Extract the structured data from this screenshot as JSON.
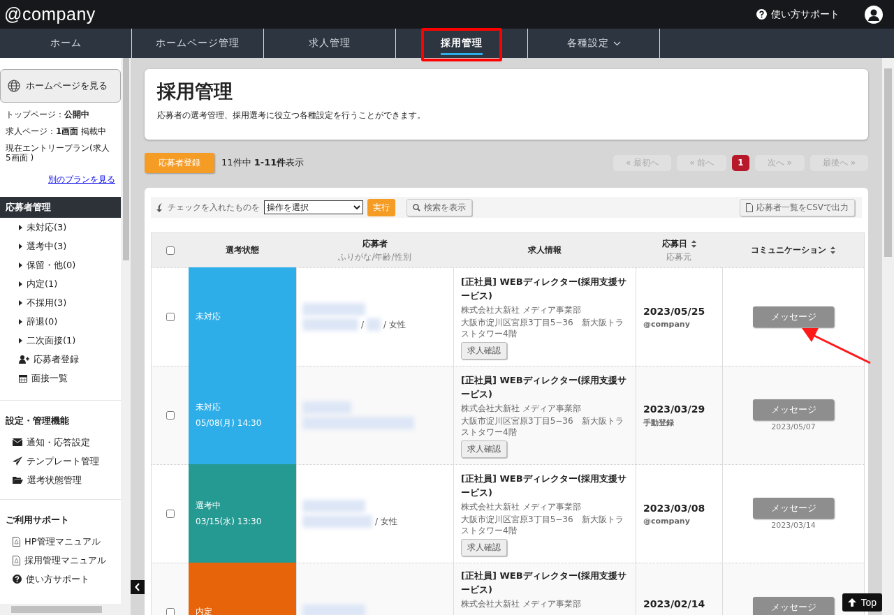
{
  "header": {
    "logo": "@company",
    "support": "使い方サポート"
  },
  "nav": [
    {
      "label": "ホーム",
      "selected": false,
      "dropdown": false,
      "highlighted": false
    },
    {
      "label": "ホームページ管理",
      "selected": false,
      "dropdown": false,
      "highlighted": false
    },
    {
      "label": "求人管理",
      "selected": false,
      "dropdown": false,
      "highlighted": false
    },
    {
      "label": "採用管理",
      "selected": true,
      "dropdown": false,
      "highlighted": true
    },
    {
      "label": "各種設定",
      "selected": false,
      "dropdown": true,
      "highlighted": false
    }
  ],
  "sidebar": {
    "view_button": "ホームページを見る",
    "status": [
      {
        "label": "トップページ：",
        "value": "公開中"
      },
      {
        "label": "求人ページ：",
        "value": "1画面",
        "rest": "掲載中"
      },
      {
        "label": "現在エントリープラン(求人 5画面 )"
      }
    ],
    "plan_link": "別のプランを見る",
    "sections": [
      {
        "title": "応募者管理",
        "dark": true,
        "items": [
          {
            "kind": "arrow",
            "label": "未対応(3)"
          },
          {
            "kind": "arrow",
            "label": "選考中(3)"
          },
          {
            "kind": "arrow",
            "label": "保留・他(0)"
          },
          {
            "kind": "arrow",
            "label": "内定(1)"
          },
          {
            "kind": "arrow",
            "label": "不採用(3)"
          },
          {
            "kind": "arrow",
            "label": "辞退(0)"
          },
          {
            "kind": "arrow",
            "label": "二次面接(1)"
          },
          {
            "kind": "user-plus",
            "label": "応募者登録"
          },
          {
            "kind": "calendar",
            "label": "面接一覧"
          }
        ]
      },
      {
        "title": "設定・管理機能",
        "dark": false,
        "items": [
          {
            "kind": "envelope",
            "label": "通知・応答設定"
          },
          {
            "kind": "send",
            "label": "テンプレート管理"
          },
          {
            "kind": "folder",
            "label": "選考状態管理"
          }
        ]
      },
      {
        "title": "ご利用サポート",
        "dark": false,
        "items": [
          {
            "kind": "pdf",
            "label": "HP管理マニュアル"
          },
          {
            "kind": "pdf",
            "label": "採用管理マニュアル"
          },
          {
            "kind": "help",
            "label": "使い方サポート"
          }
        ]
      }
    ]
  },
  "page": {
    "title": "採用管理",
    "description": "応募者の選考管理、採用選考に役立つ各種設定を行うことができます。"
  },
  "register_button": "応募者登録",
  "count": "11件中 **1-11件**表示",
  "pagination": [
    {
      "label": "« 最初へ",
      "selected": false
    },
    {
      "label": "« 前へ",
      "selected": false
    },
    {
      "label": "1",
      "selected": true
    },
    {
      "label": "次へ »",
      "selected": false
    },
    {
      "label": "最後へ »",
      "selected": false
    }
  ],
  "toolbar": {
    "bulk_label": "チェックを入れたものを",
    "bulk_select": "操作を選択",
    "run_button": "実行",
    "search_button": "検索を表示",
    "csv_button": "応募者一覧をCSVで出力"
  },
  "table": {
    "select_all_checked": false,
    "columns": [
      {
        "label": "選考状態",
        "sortable": false
      },
      {
        "label": "応募者",
        "sub": "ふりがな/年齢/性別",
        "sortable": false
      },
      {
        "label": "求人情報",
        "sortable": false
      },
      {
        "label": "応募日",
        "sub": "応募元",
        "sortable": true
      },
      {
        "label": "コミュニケーション",
        "sortable": true
      }
    ],
    "rows": [
      {
        "checked": false,
        "status": "未対応",
        "color": "#2eaee8",
        "applicant": [
          "/",
          "/ 女性"
        ],
        "job_title": "[正社員] WEBディレクター(採用支援サービス)",
        "company": "株式会社大新社 メディア事業部",
        "address": "大阪市淀川区宮原3丁目5−36　新大阪トラストタワー4階",
        "job_button": "求人確認",
        "date": "2023/05/25",
        "source": "@company",
        "message": "メッセージ"
      },
      {
        "checked": false,
        "status": "未対応",
        "status_time": "05/08(月) 14:30",
        "color": "#2eaee8",
        "job_title": "[正社員] WEBディレクター(採用支援サービス)",
        "company": "株式会社大新社 メディア事業部",
        "address": "大阪市淀川区宮原3丁目5−36　新大阪トラストタワー4階",
        "job_button": "求人確認",
        "date": "2023/03/29",
        "source": "手動登録",
        "message": "メッセージ",
        "message_date": "2023/05/07"
      },
      {
        "checked": false,
        "status": "選考中",
        "status_time": "03/15(水) 13:30",
        "color": "#259a92",
        "applicant": [
          "/ 女性"
        ],
        "job_title": "[正社員] WEBディレクター(採用支援サービス)",
        "company": "株式会社大新社 メディア事業部",
        "address": "大阪市淀川区宮原3丁目5−36　新大阪トラストタワー4階",
        "job_button": "求人確認",
        "date": "2023/03/08",
        "source": "@company",
        "message": "メッセージ",
        "message_date": "2023/03/14"
      },
      {
        "checked": false,
        "status": "内定",
        "color": "#e8640a",
        "job_title": "[正社員] WEBディレクター(採用支援サービス)",
        "company": "株式会社大新社 メディア事業部",
        "date": "2023/02/14",
        "message": "メッセージ"
      }
    ]
  },
  "top_button": "Top"
}
